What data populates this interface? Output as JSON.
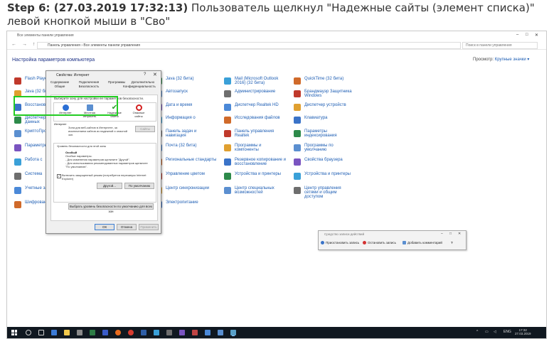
{
  "caption": {
    "step": "Step 6: (27.03.2019 17:32:13)",
    "text": " Пользователь щелкнул \"Надежные сайты (элемент списка)\" левой кнопкой мыши в \"Сво\""
  },
  "explorer": {
    "title": "Все элементы панели управления",
    "nav": "← → ↑",
    "path": "Панель управления › Все элементы панели управления",
    "search_placeholder": "Поиск в панели управления",
    "heading": "Настройка параметров компьютера",
    "viewby_label": "Просмотр:",
    "viewby_value": "Крупные значки ▾"
  },
  "items": {
    "col0": [
      "Flash Player",
      "Java (32 бита)",
      "Восстановление",
      "Диспетчер учетных данных",
      "КриптоПро",
      "Параметры",
      "Работа с",
      "Система",
      "Учетные записи",
      "Шифрование BitLocker"
    ],
    "col1": [
      "Java (32 бита)",
      "Автозапуск",
      "Дата и время",
      "Информация о",
      "Панель задач и навигация",
      "Почта (32 бита)",
      "Региональные стандарты",
      "Управление цветом",
      "Центр синхронизации",
      "Электропитание"
    ],
    "col2": [
      "Mail (Microsoft Outlook 2016) (32 бита)",
      "Администрирование",
      "Диспетчер Realtek HD",
      "Исследования файлов",
      "Панель управления Realtek",
      "Программы и компоненты",
      "Резервное копирование и восстановление",
      "Устройства и принтеры",
      "Центр специальных возможностей"
    ],
    "col3": [
      "QuickTime (32 бита)",
      "Брандмауэр Защитника Windows",
      "Диспетчер устройств",
      "Клавиатура",
      "Параметры индексирования",
      "Программы по умолчанию",
      "Свойства браузера",
      "Устройства и принтеры",
      "Центр управления сетями и общим доступом"
    ]
  },
  "dialog": {
    "title": "Свойства: Интернет",
    "help": "?",
    "close": "✕",
    "tabs": [
      "Содержание",
      "Общие",
      "Подключения",
      "Безопасность",
      "Программы",
      "Дополнительно",
      "Конфиденциальность"
    ],
    "select_zone_label": "Выберите зону для настройки ее параметров безопасности.",
    "zones": [
      "Интернет",
      "Местная интрасеть",
      "Надежные сайты",
      "Опасные сайты"
    ],
    "zone_title": "Интернет",
    "zone_desc": "Зона для веб-сайтов в Интернете, за исключением сайтов из надежной и опасной зон.",
    "sites_button": "Сайты",
    "level_label": "Уровень безопасности для этой зоны",
    "level_name": "Особый",
    "level_desc1": "Особые параметры.",
    "level_desc2": "- Для изменения параметров щелкните \"Другой\".",
    "level_desc3": "- Для использования рекомендованных параметров щелкните \"По умолчанию\".",
    "protected_mode": "Включить защищенный режим (потребуется перезапуск Internet Explorer)",
    "custom_button": "Другой...",
    "default_button": "По умолчанию",
    "reset_all_button": "Выбрать уровень безопасности по умолчанию для всех зон",
    "ok_button": "ОК",
    "cancel_button": "Отмена",
    "apply_button": "Применить"
  },
  "recorder": {
    "title": "Средство записи действий",
    "pause": "Приостановить запись",
    "stop": "Остановить запись",
    "add_comment": "Добавить комментарий",
    "help": "?"
  },
  "taskbar": {
    "lang": "ENG",
    "time": "17:32",
    "date": "27.03.2019"
  }
}
